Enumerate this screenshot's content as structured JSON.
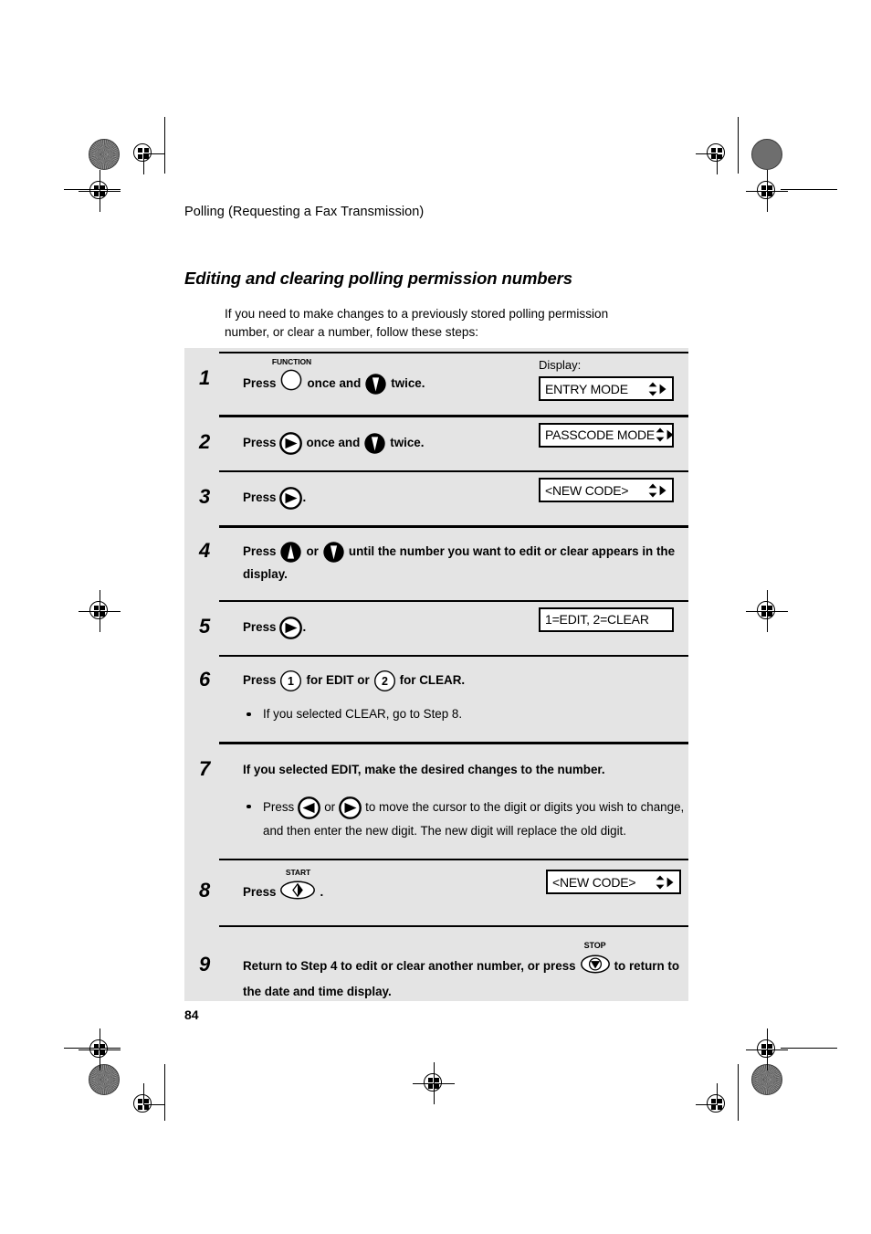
{
  "document": {
    "running_head": "Polling (Requesting a Fax Transmission)",
    "section_title": "Editing and clearing polling permission numbers",
    "intro": "If you need to make changes to a previously stored polling permission number, or clear a number, follow these steps:",
    "page_number": "84",
    "display_column_label": "Display:"
  },
  "colors": {
    "panel_background": "#e4e4e4",
    "text": "#000000",
    "page_background": "#ffffff",
    "display_box_background": "#ffffff"
  },
  "steps": [
    {
      "number": "1",
      "text_before": "Press",
      "icon_1": "function-button-icon",
      "icon_1_caption": "FUNCTION",
      "text_middle": "once and",
      "icon_2": "down-arrow-button-icon",
      "text_after": "twice.",
      "display": "ENTRY MODE"
    },
    {
      "number": "2",
      "text_before": "Press",
      "icon_1": "right-arrow-button-icon",
      "text_middle": "once and",
      "icon_2": "down-arrow-button-icon",
      "text_after": "twice.",
      "display": "PASSCODE MODE"
    },
    {
      "number": "3",
      "text_before": "Press",
      "icon_1": "right-arrow-button-icon",
      "text_after": ".",
      "display": "<NEW CODE>"
    },
    {
      "number": "4",
      "text_before": "Press",
      "icon_1": "up-arrow-button-icon",
      "text_middle": "or",
      "icon_2": "down-arrow-button-icon",
      "text_after": "until the number you want to edit or clear appears in the display.",
      "display": ""
    },
    {
      "number": "5",
      "text_before": "Press",
      "icon_1": "right-arrow-button-icon",
      "text_after": ".",
      "display": "1=EDIT, 2=CLEAR"
    },
    {
      "number": "6",
      "text_before": "Press",
      "icon_1": "key-1-button-icon",
      "text_middle": "for EDIT or",
      "icon_2": "key-2-button-icon",
      "text_after": "for CLEAR.",
      "bullet": "If you selected CLEAR, go to Step 8.",
      "display": ""
    },
    {
      "number": "7",
      "heading": "If you selected EDIT, make the desired changes to the number.",
      "bullet_before": "Press",
      "icon_1": "left-arrow-button-icon",
      "bullet_middle": "or",
      "icon_2": "right-arrow-button-icon",
      "bullet_after": "to move the cursor to the digit or digits you wish to change, and then enter the new digit. The new digit will replace the old digit.",
      "display": ""
    },
    {
      "number": "8",
      "text_before": "Press",
      "icon_1": "start-button-icon",
      "icon_1_caption": "START",
      "text_after": ".",
      "display": "<NEW CODE>"
    },
    {
      "number": "9",
      "text_before": "Return to Step 4 to edit or clear another number, or press",
      "icon_1": "stop-button-icon",
      "icon_1_caption": "STOP",
      "text_after": "to return to the date and time display.",
      "display": ""
    }
  ]
}
